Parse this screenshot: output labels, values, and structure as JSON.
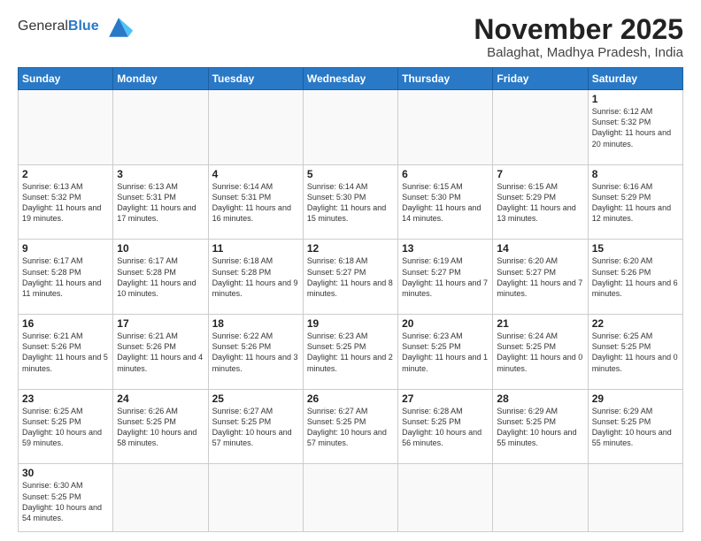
{
  "header": {
    "logo_general": "General",
    "logo_blue": "Blue",
    "month_title": "November 2025",
    "subtitle": "Balaghat, Madhya Pradesh, India"
  },
  "weekdays": [
    "Sunday",
    "Monday",
    "Tuesday",
    "Wednesday",
    "Thursday",
    "Friday",
    "Saturday"
  ],
  "days": [
    {
      "date": "",
      "info": ""
    },
    {
      "date": "",
      "info": ""
    },
    {
      "date": "",
      "info": ""
    },
    {
      "date": "",
      "info": ""
    },
    {
      "date": "",
      "info": ""
    },
    {
      "date": "",
      "info": ""
    },
    {
      "date": "1",
      "info": "Sunrise: 6:12 AM\nSunset: 5:32 PM\nDaylight: 11 hours\nand 20 minutes."
    },
    {
      "date": "2",
      "info": "Sunrise: 6:13 AM\nSunset: 5:32 PM\nDaylight: 11 hours\nand 19 minutes."
    },
    {
      "date": "3",
      "info": "Sunrise: 6:13 AM\nSunset: 5:31 PM\nDaylight: 11 hours\nand 17 minutes."
    },
    {
      "date": "4",
      "info": "Sunrise: 6:14 AM\nSunset: 5:31 PM\nDaylight: 11 hours\nand 16 minutes."
    },
    {
      "date": "5",
      "info": "Sunrise: 6:14 AM\nSunset: 5:30 PM\nDaylight: 11 hours\nand 15 minutes."
    },
    {
      "date": "6",
      "info": "Sunrise: 6:15 AM\nSunset: 5:30 PM\nDaylight: 11 hours\nand 14 minutes."
    },
    {
      "date": "7",
      "info": "Sunrise: 6:15 AM\nSunset: 5:29 PM\nDaylight: 11 hours\nand 13 minutes."
    },
    {
      "date": "8",
      "info": "Sunrise: 6:16 AM\nSunset: 5:29 PM\nDaylight: 11 hours\nand 12 minutes."
    },
    {
      "date": "9",
      "info": "Sunrise: 6:17 AM\nSunset: 5:28 PM\nDaylight: 11 hours\nand 11 minutes."
    },
    {
      "date": "10",
      "info": "Sunrise: 6:17 AM\nSunset: 5:28 PM\nDaylight: 11 hours\nand 10 minutes."
    },
    {
      "date": "11",
      "info": "Sunrise: 6:18 AM\nSunset: 5:28 PM\nDaylight: 11 hours\nand 9 minutes."
    },
    {
      "date": "12",
      "info": "Sunrise: 6:18 AM\nSunset: 5:27 PM\nDaylight: 11 hours\nand 8 minutes."
    },
    {
      "date": "13",
      "info": "Sunrise: 6:19 AM\nSunset: 5:27 PM\nDaylight: 11 hours\nand 7 minutes."
    },
    {
      "date": "14",
      "info": "Sunrise: 6:20 AM\nSunset: 5:27 PM\nDaylight: 11 hours\nand 7 minutes."
    },
    {
      "date": "15",
      "info": "Sunrise: 6:20 AM\nSunset: 5:26 PM\nDaylight: 11 hours\nand 6 minutes."
    },
    {
      "date": "16",
      "info": "Sunrise: 6:21 AM\nSunset: 5:26 PM\nDaylight: 11 hours\nand 5 minutes."
    },
    {
      "date": "17",
      "info": "Sunrise: 6:21 AM\nSunset: 5:26 PM\nDaylight: 11 hours\nand 4 minutes."
    },
    {
      "date": "18",
      "info": "Sunrise: 6:22 AM\nSunset: 5:26 PM\nDaylight: 11 hours\nand 3 minutes."
    },
    {
      "date": "19",
      "info": "Sunrise: 6:23 AM\nSunset: 5:25 PM\nDaylight: 11 hours\nand 2 minutes."
    },
    {
      "date": "20",
      "info": "Sunrise: 6:23 AM\nSunset: 5:25 PM\nDaylight: 11 hours\nand 1 minute."
    },
    {
      "date": "21",
      "info": "Sunrise: 6:24 AM\nSunset: 5:25 PM\nDaylight: 11 hours\nand 0 minutes."
    },
    {
      "date": "22",
      "info": "Sunrise: 6:25 AM\nSunset: 5:25 PM\nDaylight: 11 hours\nand 0 minutes."
    },
    {
      "date": "23",
      "info": "Sunrise: 6:25 AM\nSunset: 5:25 PM\nDaylight: 10 hours\nand 59 minutes."
    },
    {
      "date": "24",
      "info": "Sunrise: 6:26 AM\nSunset: 5:25 PM\nDaylight: 10 hours\nand 58 minutes."
    },
    {
      "date": "25",
      "info": "Sunrise: 6:27 AM\nSunset: 5:25 PM\nDaylight: 10 hours\nand 57 minutes."
    },
    {
      "date": "26",
      "info": "Sunrise: 6:27 AM\nSunset: 5:25 PM\nDaylight: 10 hours\nand 57 minutes."
    },
    {
      "date": "27",
      "info": "Sunrise: 6:28 AM\nSunset: 5:25 PM\nDaylight: 10 hours\nand 56 minutes."
    },
    {
      "date": "28",
      "info": "Sunrise: 6:29 AM\nSunset: 5:25 PM\nDaylight: 10 hours\nand 55 minutes."
    },
    {
      "date": "29",
      "info": "Sunrise: 6:29 AM\nSunset: 5:25 PM\nDaylight: 10 hours\nand 55 minutes."
    },
    {
      "date": "30",
      "info": "Sunrise: 6:30 AM\nSunset: 5:25 PM\nDaylight: 10 hours\nand 54 minutes."
    }
  ]
}
